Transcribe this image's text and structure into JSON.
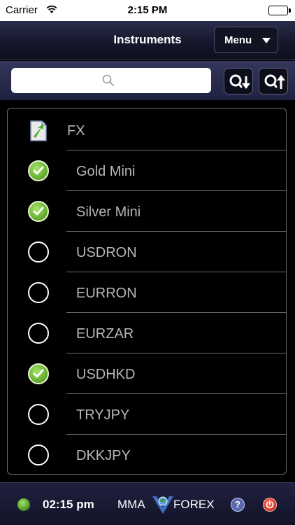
{
  "statusbar": {
    "carrier": "Carrier",
    "time": "2:15 PM"
  },
  "navbar": {
    "title": "Instruments",
    "menu_label": "Menu"
  },
  "search": {
    "placeholder": ""
  },
  "list": {
    "group": {
      "label": "FX",
      "icon": "folder-icon"
    },
    "items": [
      {
        "label": "Gold Mini",
        "checked": true
      },
      {
        "label": "Silver Mini",
        "checked": true
      },
      {
        "label": "USDRON",
        "checked": false
      },
      {
        "label": "EURRON",
        "checked": false
      },
      {
        "label": "EURZAR",
        "checked": false
      },
      {
        "label": "USDHKD",
        "checked": true
      },
      {
        "label": "TRYJPY",
        "checked": false
      },
      {
        "label": "DKKJPY",
        "checked": false
      }
    ]
  },
  "bottombar": {
    "clock": "02:15 pm",
    "brand_left": "MMA",
    "brand_right": "FOREX",
    "help": "?"
  },
  "colors": {
    "accent": "#2a2d4a",
    "check": "#5ea82a"
  }
}
